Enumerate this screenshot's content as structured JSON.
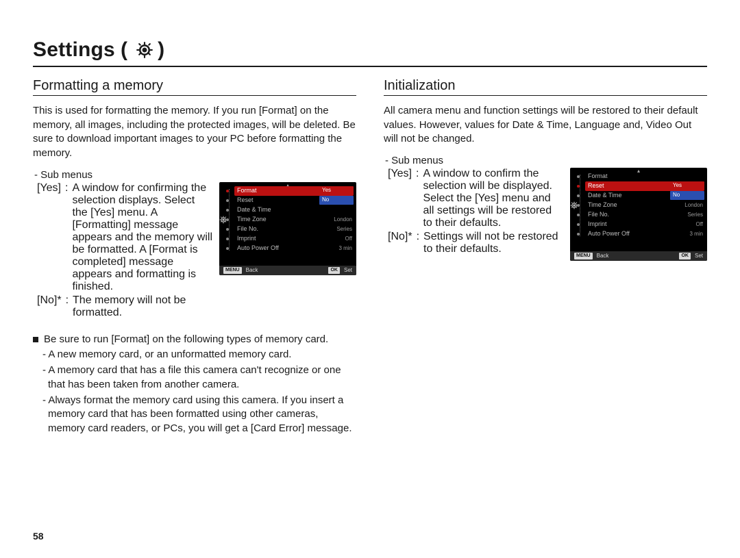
{
  "page_number": "58",
  "title": {
    "text": "Settings",
    "open_paren": "(",
    "close_paren": ")",
    "icon_name": "gear-icon"
  },
  "left": {
    "heading": "Formatting a memory",
    "body": "This is used for formatting the memory. If you run [Format] on the memory, all images, including the protected images, will be deleted. Be sure to download important images to your PC before formatting the memory.",
    "sub_menu_label": "- Sub menus",
    "defs": [
      {
        "key": "[Yes]",
        "val": "A window for confirming the selection displays. Select the [Yes] menu. A [Formatting] message appears and the memory will be formatted. A [Format is completed] message appears and formatting is finished."
      },
      {
        "key": "[No]*",
        "val": "The memory will not be formatted."
      }
    ],
    "note_head": "Be sure to run [Format] on the following types of memory card.",
    "note_items": [
      "- A new memory card, or an unformatted memory card.",
      "- A memory card that has a file this camera can't recognize or one that has been taken from another camera.",
      "- Always format the memory card using this camera. If you insert a memory card that has been formatted using other cameras, memory card readers, or PCs, you will get a [Card Error] message."
    ]
  },
  "right": {
    "heading": "Initialization",
    "body": "All camera menu and function settings will be restored to their default values. However, values for Date & Time, Language and, Video Out will not be changed.",
    "sub_menu_label": "- Sub menus",
    "defs": [
      {
        "key": "[Yes]",
        "val": "A window to confirm the selection will be displayed. Select the [Yes] menu and all settings will be restored to their defaults."
      },
      {
        "key": "[No]*",
        "val": "Settings will not be restored to their defaults."
      }
    ]
  },
  "cam_left": {
    "highlight_label": "Format",
    "rows": [
      {
        "label": "Format",
        "value": ""
      },
      {
        "label": "Reset",
        "value": ""
      },
      {
        "label": "Date & Time",
        "value": ""
      },
      {
        "label": "Time Zone",
        "value": "London"
      },
      {
        "label": "File No.",
        "value": "Series"
      },
      {
        "label": "Imprint",
        "value": "Off"
      },
      {
        "label": "Auto Power Off",
        "value": "3 min"
      }
    ],
    "picker": {
      "options": [
        "Yes",
        "No"
      ],
      "selected_index": 1
    },
    "footer": {
      "left_box": "MENU",
      "left_text": "Back",
      "right_box": "OK",
      "right_text": "Set"
    }
  },
  "cam_right": {
    "highlight_label": "Reset",
    "rows": [
      {
        "label": "Format",
        "value": ""
      },
      {
        "label": "Reset",
        "value": ""
      },
      {
        "label": "Date & Time",
        "value": ""
      },
      {
        "label": "Time Zone",
        "value": "London"
      },
      {
        "label": "File No.",
        "value": "Series"
      },
      {
        "label": "Imprint",
        "value": "Off"
      },
      {
        "label": "Auto Power Off",
        "value": "3 min"
      }
    ],
    "picker": {
      "options": [
        "Yes",
        "No"
      ],
      "selected_index": 1
    },
    "footer": {
      "left_box": "MENU",
      "left_text": "Back",
      "right_box": "OK",
      "right_text": "Set"
    }
  }
}
